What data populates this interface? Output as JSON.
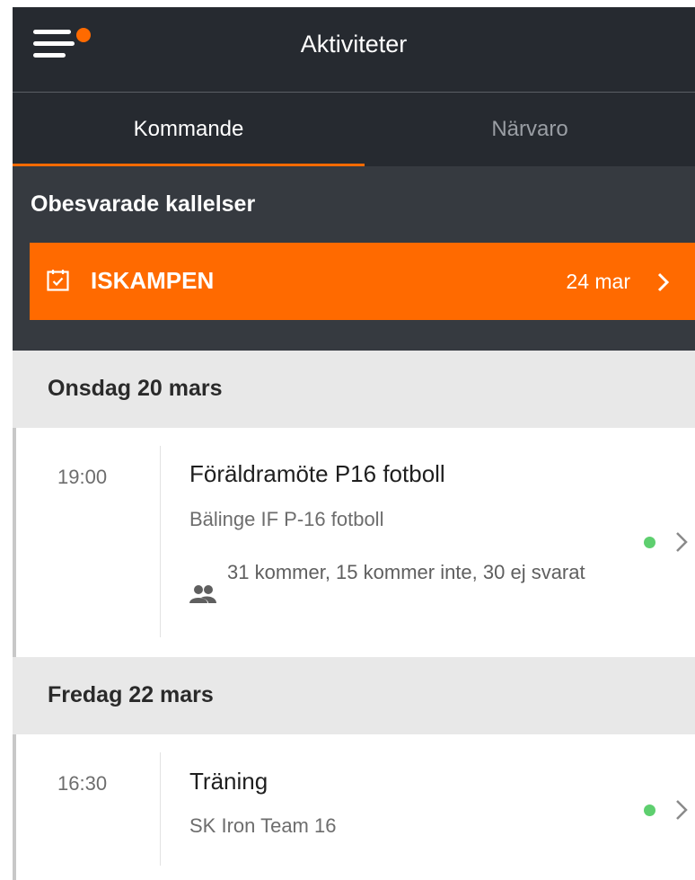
{
  "header": {
    "title": "Aktiviteter",
    "menu_icon": "hamburger-menu-icon",
    "notification_dot_color": "#ff6a00"
  },
  "tabs": [
    {
      "label": "Kommande",
      "active": true
    },
    {
      "label": "Närvaro",
      "active": false
    }
  ],
  "unanswered": {
    "title": "Obesvarade kallelser",
    "items": [
      {
        "icon": "calendar-check-icon",
        "title": "ISKAMPEN",
        "date": "24 mar"
      }
    ]
  },
  "days": [
    {
      "label": "Onsdag 20 mars",
      "events": [
        {
          "time": "19:00",
          "title": "Föräldramöte P16 fotboll",
          "team": "Bälinge IF P-16 fotboll",
          "attendance": "31 kommer, 15 kommer inte, 30 ej svarat",
          "status_color": "#5ecf6f"
        }
      ]
    },
    {
      "label": "Fredag 22 mars",
      "events": [
        {
          "time": "16:30",
          "title": "Träning",
          "team": "SK Iron Team 16",
          "status_color": "#5ecf6f"
        }
      ]
    }
  ],
  "colors": {
    "accent": "#ff6a00",
    "header_bg": "#262a30",
    "section_bg": "#363a40",
    "day_header_bg": "#e8e8e8"
  }
}
